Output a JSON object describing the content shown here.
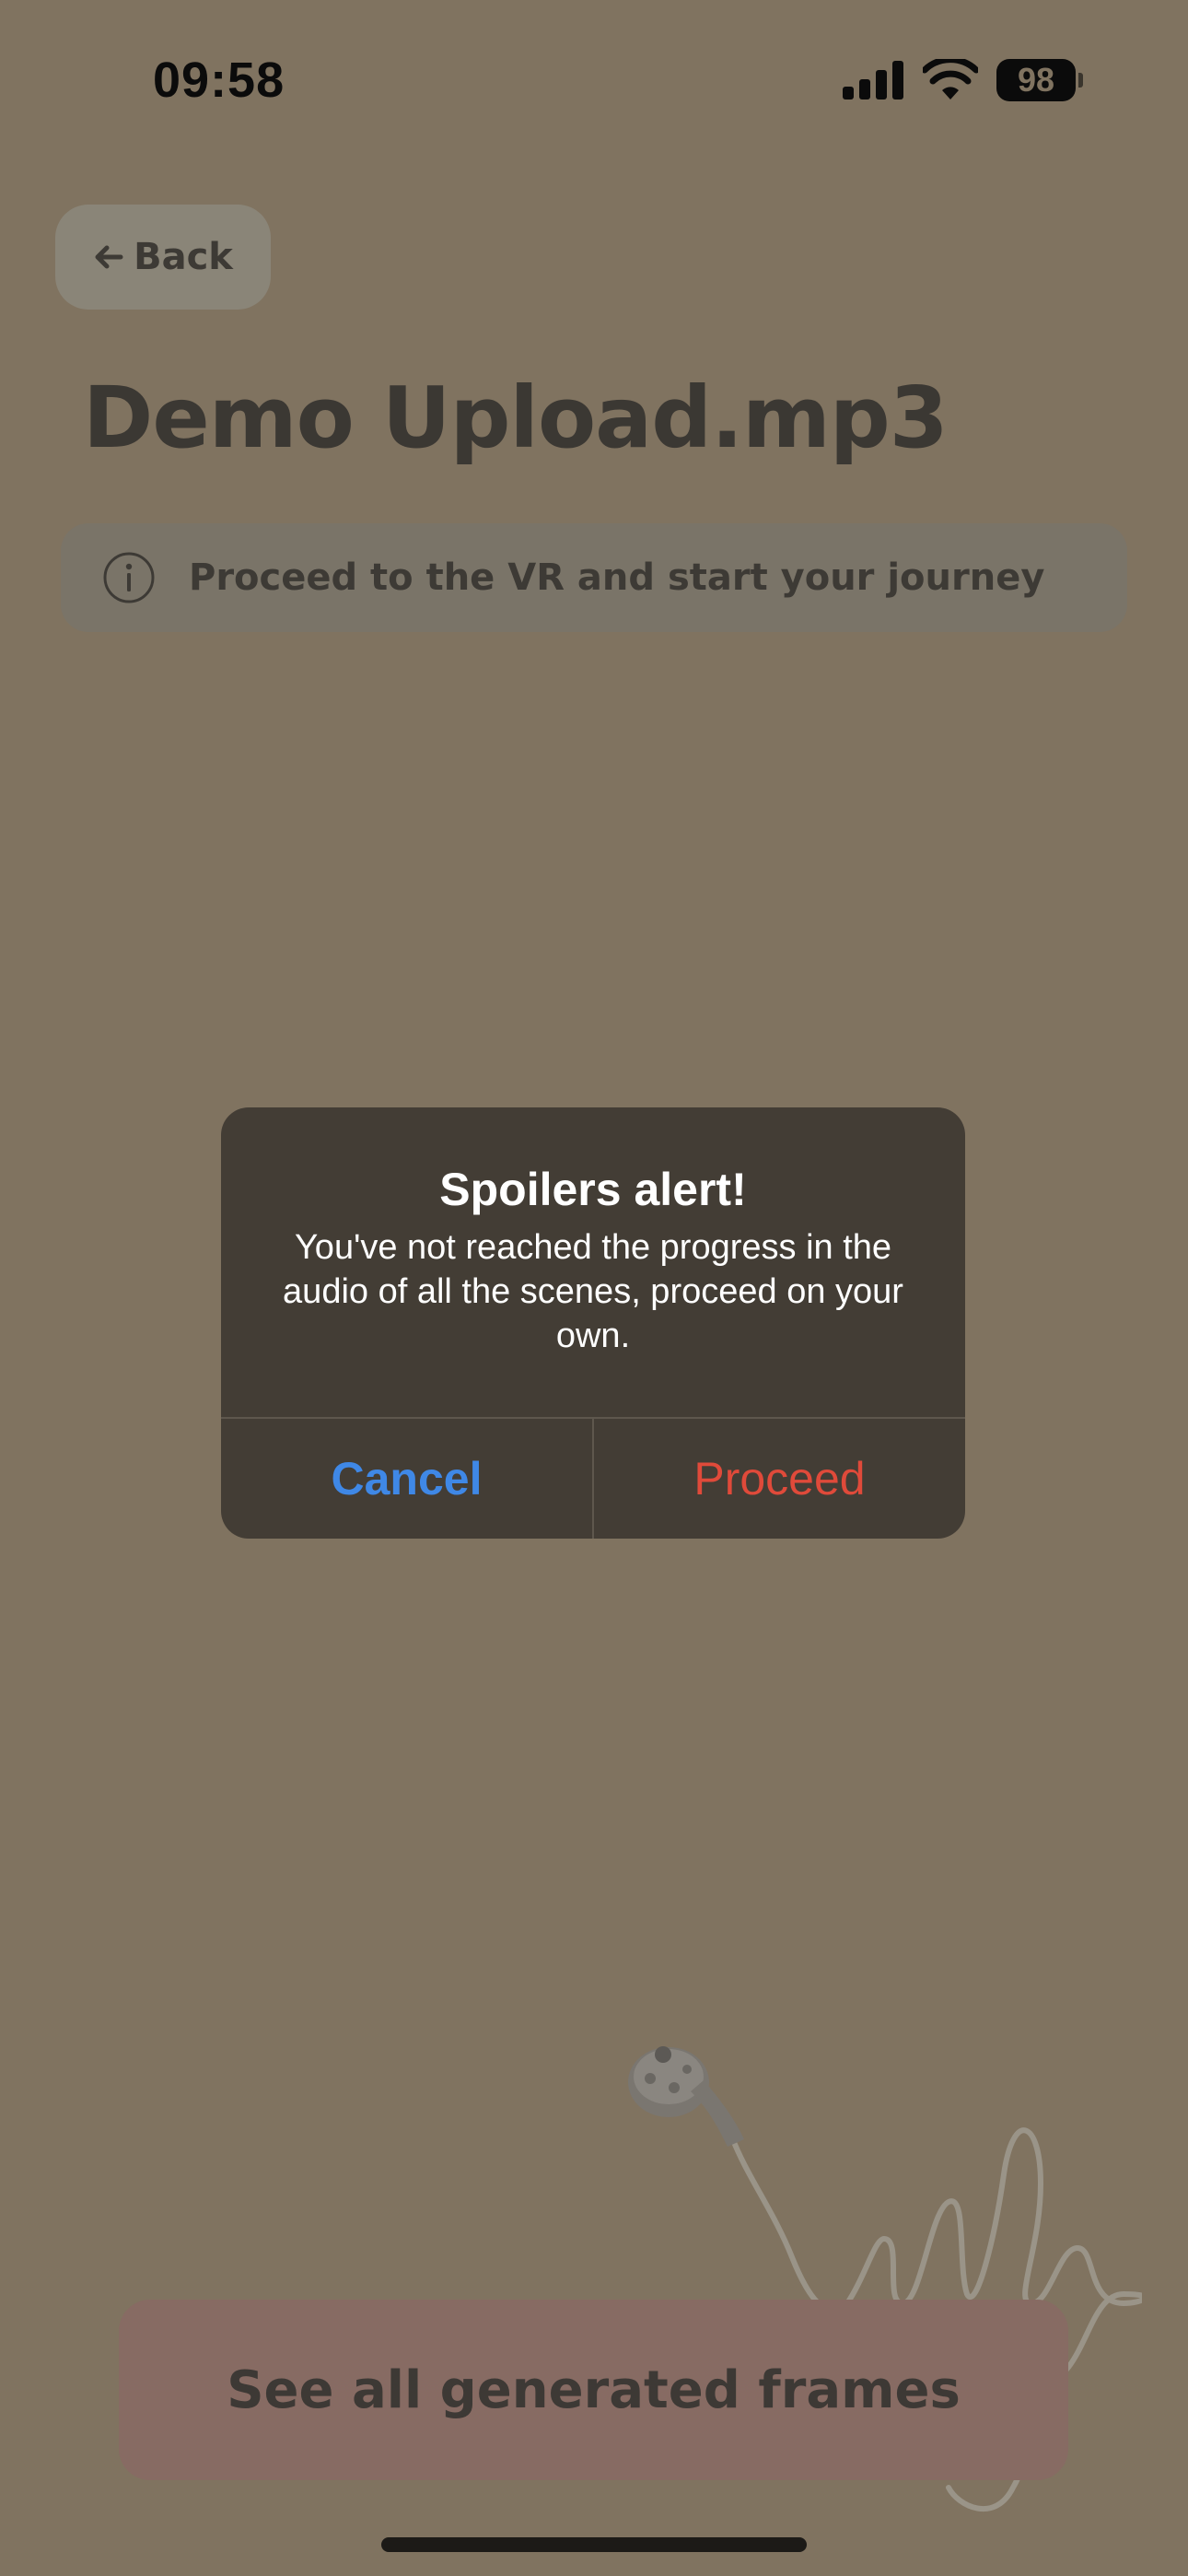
{
  "status_bar": {
    "time": "09:58",
    "battery": "98"
  },
  "header": {
    "back_label": "Back",
    "title": "Demo Upload.mp3"
  },
  "info_banner": {
    "text": "Proceed to the VR and start your journey",
    "icon": "info-icon"
  },
  "alert": {
    "title": "Spoilers alert!",
    "message": "You've not reached the progress in the audio of all the scenes, proceed on your own.",
    "cancel_label": "Cancel",
    "proceed_label": "Proceed"
  },
  "bottom": {
    "frames_button_label": "See all generated frames"
  },
  "colors": {
    "overlay_background": "#807360",
    "alert_background": "#433d35",
    "cancel": "#3f88e6",
    "proceed": "#e04a3a",
    "frames_button": "#876b63"
  }
}
